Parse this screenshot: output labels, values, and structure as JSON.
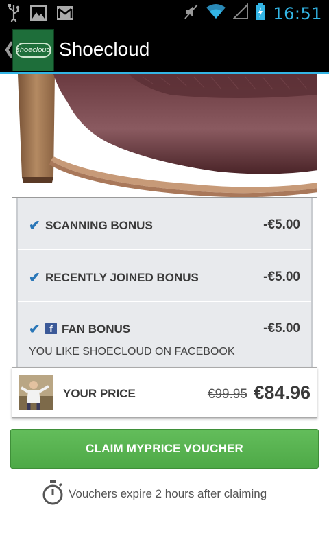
{
  "status_bar": {
    "time": "16:51",
    "icons": [
      "usb-icon",
      "image-icon",
      "gmail-icon",
      "mute-icon",
      "wifi-icon",
      "signal-icon",
      "battery-charging-icon"
    ],
    "accent_color": "#33b5e5"
  },
  "action_bar": {
    "title": "Shoecloud",
    "logo_text": "shoecloud"
  },
  "bonuses": [
    {
      "label": "SCANNING BONUS",
      "amount": "-€5.00",
      "checked": true
    },
    {
      "label": "RECENTLY JOINED BONUS",
      "amount": "-€5.00",
      "checked": true
    },
    {
      "label": "FAN BONUS",
      "amount": "-€5.00",
      "checked": true,
      "icon": "facebook-icon",
      "subtext": "YOU LIKE SHOECLOUD ON FACEBOOK"
    }
  ],
  "price": {
    "label": "YOUR PRICE",
    "old_price": "€99.95",
    "new_price": "€84.96"
  },
  "claim_button": {
    "label": "CLAIM MYPRICE VOUCHER",
    "color": "#57b24f"
  },
  "expiry": {
    "text": "Vouchers expire 2 hours after claiming",
    "icon": "stopwatch-icon"
  }
}
